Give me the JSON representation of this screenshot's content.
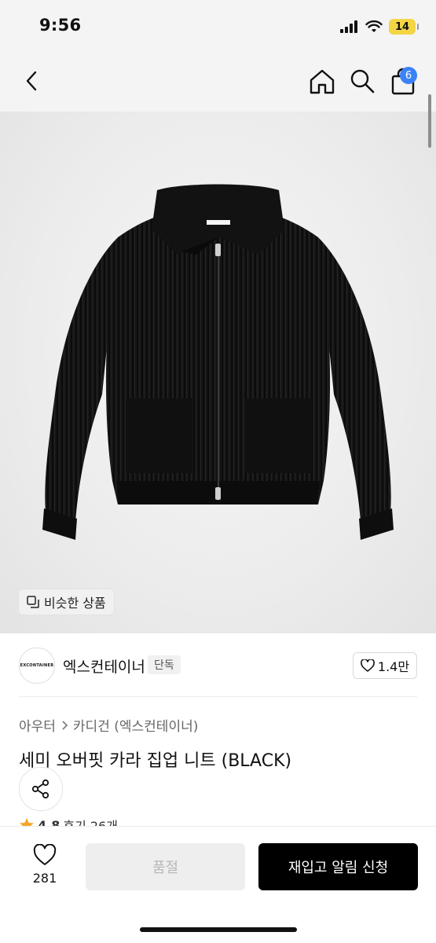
{
  "status": {
    "time": "9:56",
    "battery": "14"
  },
  "nav": {
    "cart_count": "6"
  },
  "hero": {
    "similar_label": "비슷한 상품",
    "garment_label": "EXCONTAINER"
  },
  "brand": {
    "name": "엑스컨테이너",
    "badge": "단독",
    "likes": "1.4만",
    "logo_text": "EXCONTAINER"
  },
  "breadcrumb": {
    "category": "아우터",
    "subcategory": "카디건 (엑스컨테이너)"
  },
  "product": {
    "title": "세미 오버핏 카라 집업 니트 (BLACK)",
    "rating": "4.8",
    "reviews": "후기 26개"
  },
  "bottom": {
    "wish_count": "281",
    "soldout_label": "품절",
    "restock_label": "재입고 알림 신청"
  },
  "colors": {
    "accent_badge": "#3b82f6",
    "primary_button": "#000000",
    "star": "#f5a623"
  }
}
